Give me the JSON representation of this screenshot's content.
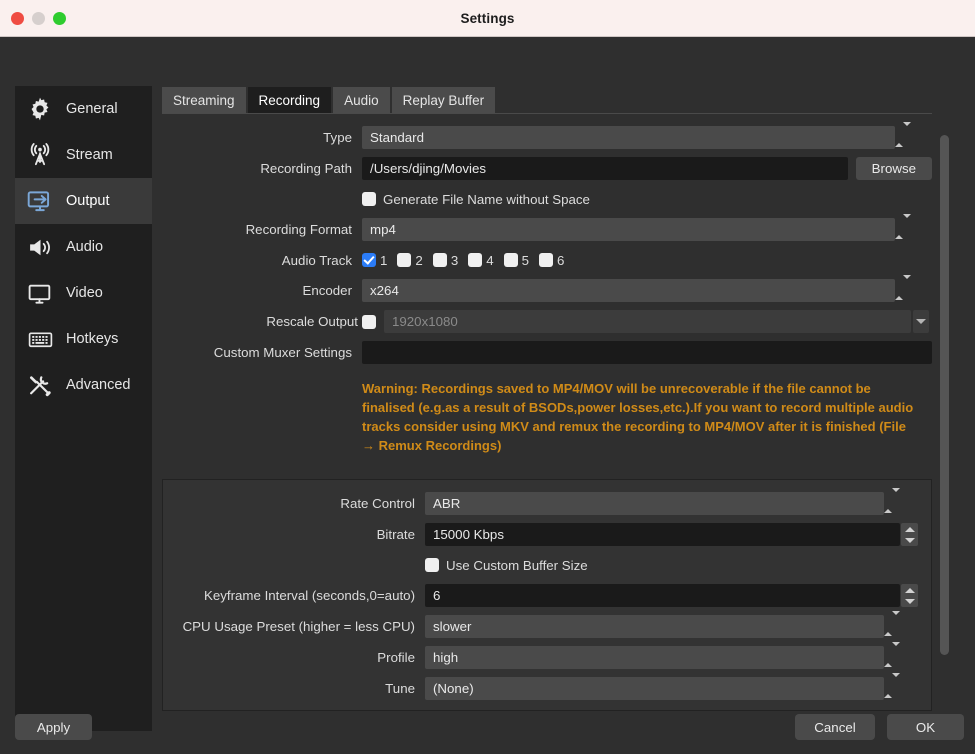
{
  "window": {
    "title": "Settings",
    "traffic_lights": [
      "close",
      "minimize",
      "zoom"
    ]
  },
  "sidebar": {
    "items": [
      {
        "label": "General",
        "icon": "gear-icon",
        "active": false
      },
      {
        "label": "Stream",
        "icon": "broadcast-tower-icon",
        "active": false
      },
      {
        "label": "Output",
        "icon": "monitor-arrow-icon",
        "active": true
      },
      {
        "label": "Audio",
        "icon": "speaker-icon",
        "active": false
      },
      {
        "label": "Video",
        "icon": "monitor-icon",
        "active": false
      },
      {
        "label": "Hotkeys",
        "icon": "keyboard-icon",
        "active": false
      },
      {
        "label": "Advanced",
        "icon": "tools-icon",
        "active": false
      }
    ]
  },
  "tabs": [
    {
      "label": "Streaming",
      "active": false
    },
    {
      "label": "Recording",
      "active": true
    },
    {
      "label": "Audio",
      "active": false
    },
    {
      "label": "Replay Buffer",
      "active": false
    }
  ],
  "form": {
    "type": {
      "label": "Type",
      "value": "Standard"
    },
    "recording_path": {
      "label": "Recording Path",
      "value": "/Users/djing/Movies",
      "browse_label": "Browse"
    },
    "generate_no_space": {
      "label": "Generate File Name without Space",
      "checked": false
    },
    "recording_format": {
      "label": "Recording Format",
      "value": "mp4"
    },
    "audio_track": {
      "label": "Audio Track",
      "tracks": [
        {
          "number": "1",
          "checked": true
        },
        {
          "number": "2",
          "checked": false
        },
        {
          "number": "3",
          "checked": false
        },
        {
          "number": "4",
          "checked": false
        },
        {
          "number": "5",
          "checked": false
        },
        {
          "number": "6",
          "checked": false
        }
      ]
    },
    "encoder": {
      "label": "Encoder",
      "value": "x264"
    },
    "rescale_output": {
      "label": "Rescale Output",
      "checked": false,
      "value": "1920x1080",
      "disabled": true
    },
    "custom_muxer": {
      "label": "Custom Muxer Settings",
      "value": "",
      "placeholder": ""
    },
    "warning": "Warning: Recordings saved to MP4/MOV will be unrecoverable if the file cannot be finalised (e.g.as a result of BSODs,power losses,etc.).If you want to record multiple audio tracks consider using MKV and remux the recording to MP4/MOV after it is finished (File → Remux Recordings)"
  },
  "encoder_settings": {
    "rate_control": {
      "label": "Rate Control",
      "value": "ABR"
    },
    "bitrate": {
      "label": "Bitrate",
      "value": "15000 Kbps"
    },
    "use_custom_buffer": {
      "label": "Use Custom Buffer Size",
      "checked": false
    },
    "keyframe_interval": {
      "label": "Keyframe Interval (seconds,0=auto)",
      "value": "6"
    },
    "cpu_usage_preset": {
      "label": "CPU Usage Preset (higher = less CPU)",
      "value": "slower"
    },
    "profile": {
      "label": "Profile",
      "value": "high"
    },
    "tune": {
      "label": "Tune",
      "value": "(None)"
    }
  },
  "footer": {
    "apply_label": "Apply",
    "cancel_label": "Cancel",
    "ok_label": "OK"
  },
  "colors": {
    "accent": "#2b7cf7",
    "warning": "#d08b18",
    "titlebar": "#faf0ee",
    "sidebar": "#1f1f1f",
    "background": "#2f2f2f"
  }
}
